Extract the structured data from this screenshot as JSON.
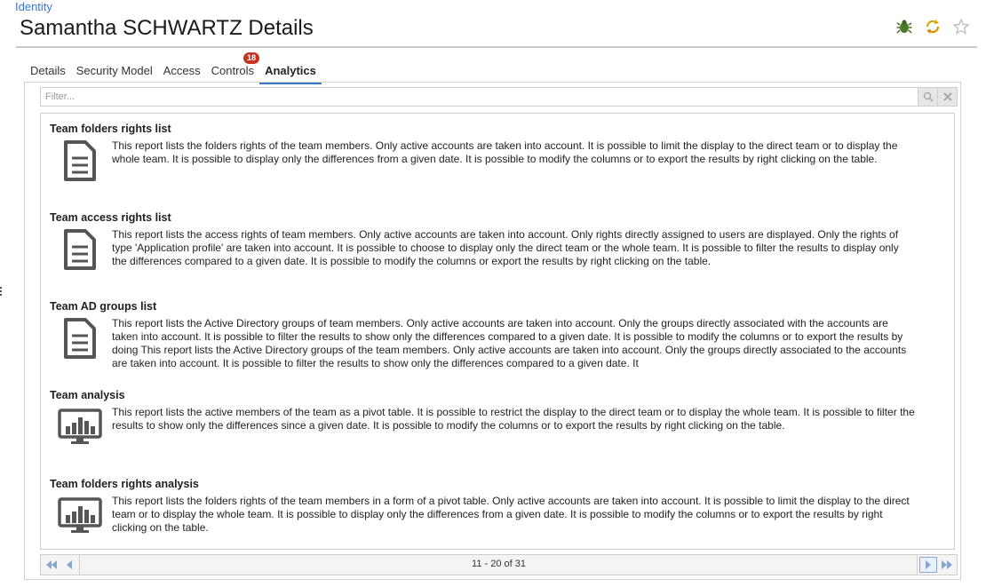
{
  "breadcrumb": "Identity",
  "title": "Samantha SCHWARTZ Details",
  "header_icons": [
    "bug-icon",
    "sync-icon",
    "star-icon"
  ],
  "colors": {
    "accent": "#3b78c4",
    "badge": "#c8321e",
    "bug": "#4a7a2a",
    "sync": "#d9a400"
  },
  "tabs": [
    {
      "label": "Details",
      "active": false
    },
    {
      "label": "Security Model",
      "active": false
    },
    {
      "label": "Access",
      "active": false
    },
    {
      "label": "Controls",
      "active": false,
      "badge": "18"
    },
    {
      "label": "Analytics",
      "active": true
    }
  ],
  "filter": {
    "placeholder": "Filter...",
    "value": ""
  },
  "reports": [
    {
      "title": "Team folders rights list",
      "icon": "document-icon",
      "description": "This report lists the folders rights of the team members. Only active accounts are taken into account. It is possible to limit the display to the direct team or to display the whole team. It is possible to display only the differences from a given date. It is possible to modify the columns or to export the results by right clicking on the table."
    },
    {
      "title": "Team access rights list",
      "icon": "document-icon",
      "description": "This report lists the access rights of team members. Only active accounts are taken into account. Only rights directly assigned to users are displayed. Only the rights of type 'Application profile' are taken into account. It is possible to choose to display only the direct team or the whole team. It is possible to filter the results to display only the differences compared to a given date. It is possible to modify the columns or export the results by right clicking on the table."
    },
    {
      "title": "Team AD groups list",
      "icon": "document-icon",
      "description": "This report lists the Active Directory groups of team members. Only active accounts are taken into account. Only the groups directly associated with the accounts are taken into account. It is possible to filter the results to show only the differences compared to a given date. It is possible to modify the columns or to export the results by doing This report lists the Active Directory groups of the team members. Only active accounts are taken into account. Only the groups directly associated to the accounts are taken into account. It is possible to filter the results to show only the differences compared to a given date. It"
    },
    {
      "title": "Team analysis",
      "icon": "chart-monitor-icon",
      "description": "This report lists the active members of the team as a pivot table. It is possible to restrict the display to the direct team or to display the whole team. It is possible to filter the results to show only the differences since a given date. It is possible to modify the columns or to export the results by right clicking on the table."
    },
    {
      "title": "Team folders rights analysis",
      "icon": "chart-monitor-icon",
      "description": "This report lists the folders rights of the team members in a form of a pivot table. Only active accounts are taken into account. It is possible to limit the display to the direct team or to display the whole team. It is possible to display only the differences from a given date. It is possible to modify the columns or to export the results by right clicking on the table."
    }
  ],
  "pager": {
    "text": "11 - 20 of 31"
  }
}
